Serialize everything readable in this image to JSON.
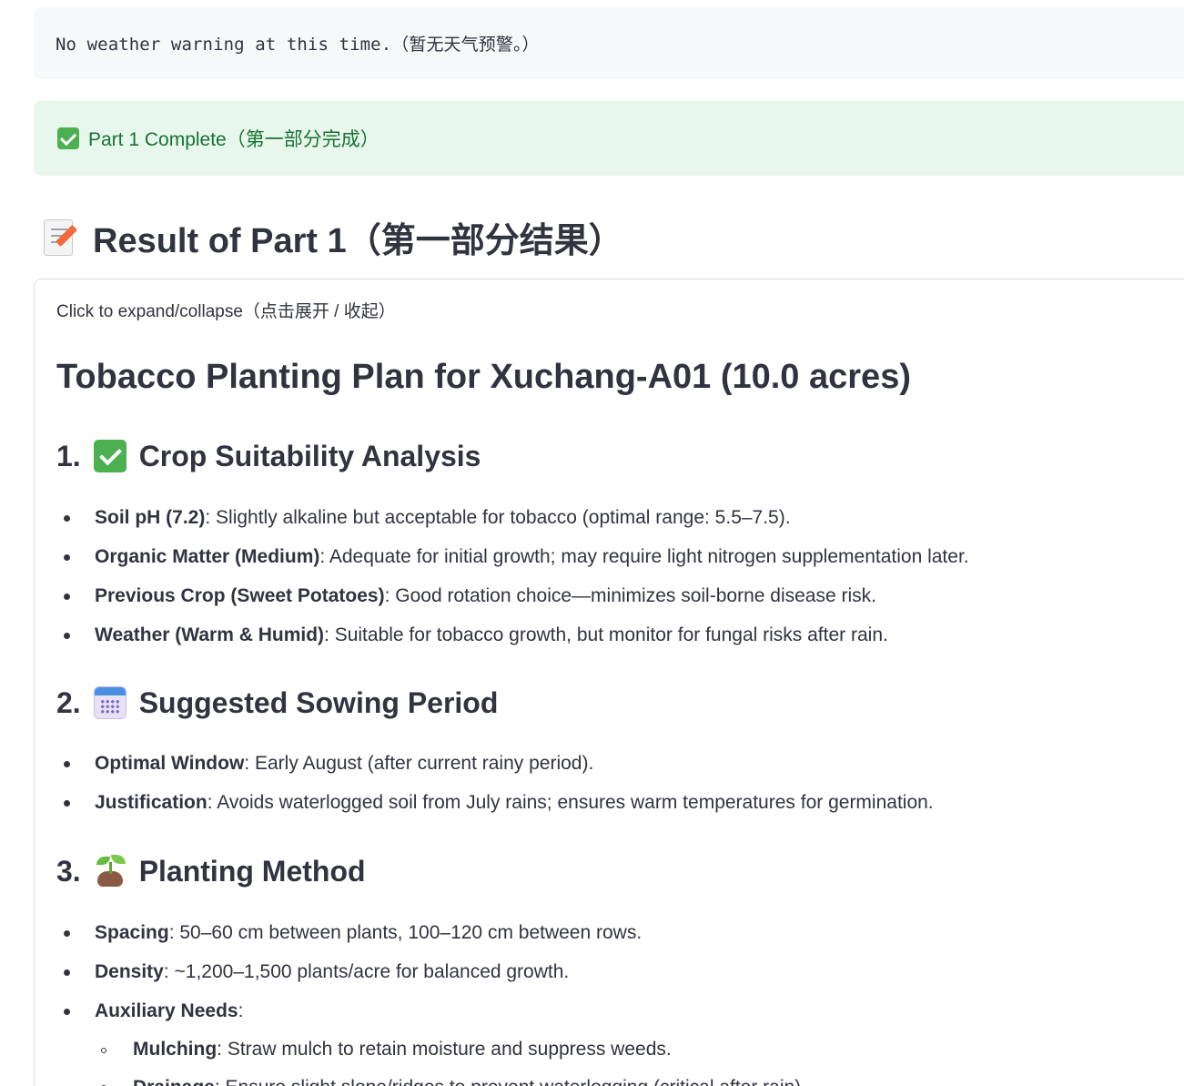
{
  "weather_notice": "No weather warning at this time.（暂无天气预警。）",
  "success_message": {
    "icon": "check-mark-button-icon",
    "text": "Part 1 Complete（第一部分完成）"
  },
  "result_heading": {
    "icon": "memo-icon",
    "text": "Result of Part 1（第一部分结果）"
  },
  "expander": {
    "label": "Click to expand/collapse（点击展开 / 收起）"
  },
  "plan": {
    "title": "Tobacco Planting Plan for Xuchang-A01 (10.0 acres)",
    "sections": [
      {
        "number": "1.",
        "icon": "check-mark-button-icon",
        "title": "Crop Suitability Analysis",
        "items": [
          {
            "term": "Soil pH (7.2)",
            "text": ": Slightly alkaline but acceptable for tobacco (optimal range: 5.5–7.5)."
          },
          {
            "term": "Organic Matter (Medium)",
            "text": ": Adequate for initial growth; may require light nitrogen supplementation later."
          },
          {
            "term": "Previous Crop (Sweet Potatoes)",
            "text": ": Good rotation choice—minimizes soil-borne disease risk."
          },
          {
            "term": "Weather (Warm & Humid)",
            "text": ": Suitable for tobacco growth, but monitor for fungal risks after rain."
          }
        ]
      },
      {
        "number": "2.",
        "icon": "calendar-icon",
        "title": "Suggested Sowing Period",
        "items": [
          {
            "term": "Optimal Window",
            "text": ": Early August (after current rainy period)."
          },
          {
            "term": "Justification",
            "text": ": Avoids waterlogged soil from July rains; ensures warm temperatures for germination."
          }
        ]
      },
      {
        "number": "3.",
        "icon": "seedling-icon",
        "title": "Planting Method",
        "items": [
          {
            "term": "Spacing",
            "text": ": 50–60 cm between plants, 100–120 cm between rows."
          },
          {
            "term": "Density",
            "text": ": ~1,200–1,500 plants/acre for balanced growth."
          },
          {
            "term": "Auxiliary Needs",
            "text": ":"
          },
          {
            "term": "Mulching",
            "text": ": Straw mulch to retain moisture and suppress weeds."
          },
          {
            "term": "Drainage",
            "text": ": Ensure slight slope/ridges to prevent waterlogging (critical after rain)."
          }
        ]
      }
    ]
  }
}
